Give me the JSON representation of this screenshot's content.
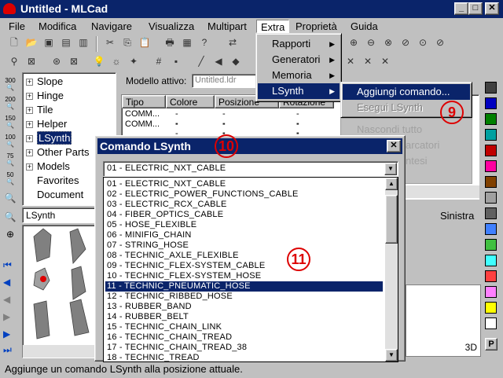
{
  "window": {
    "title": "Untitled - MLCad",
    "min_label": "_",
    "max_label": "□",
    "close_label": "✕"
  },
  "menubar": {
    "items": [
      "File",
      "Modifica",
      "Navigare",
      "Visualizza",
      "Multipart",
      "Extra",
      "Proprietà",
      "Guida"
    ]
  },
  "extra_menu": {
    "items": [
      "Rapporti",
      "Generatori",
      "Memoria",
      "LSynth"
    ]
  },
  "lsynth_menu": {
    "items": [
      {
        "label": "Aggiungi comando...",
        "enabled": true
      },
      {
        "label": "Esegui LSynth",
        "enabled": false
      }
    ]
  },
  "hidden_menu_fragments": [
    "Nascondi tutto",
    "arcatori",
    "ntesi"
  ],
  "zoom_labels": [
    "300",
    "200",
    "150",
    "100",
    "75",
    "50"
  ],
  "parts_tree": {
    "items": [
      {
        "label": "Slope",
        "expander": "+"
      },
      {
        "label": "Hinge",
        "expander": "+"
      },
      {
        "label": "Tile",
        "expander": "+"
      },
      {
        "label": "Helper",
        "expander": "+"
      },
      {
        "label": "LSynth",
        "expander": "+",
        "selected": true
      },
      {
        "label": "Other Parts",
        "expander": "+"
      },
      {
        "label": "Models",
        "expander": "+"
      },
      {
        "label": "Favorites",
        "expander": ""
      },
      {
        "label": "Document",
        "expander": ""
      }
    ]
  },
  "preview": {
    "combo_value": "LSynth"
  },
  "model": {
    "label": "Modello attivo:",
    "value": "Untitled.ldr",
    "columns": [
      "Tipo",
      "Colore",
      "Posizione",
      "Rotazione"
    ],
    "rows": [
      {
        "type": "COMM...",
        "color": "--",
        "position": "-----",
        "rotation": "-----"
      },
      {
        "type": "COMM...",
        "color": "--",
        "position": "-----",
        "rotation": "-----"
      }
    ]
  },
  "view_labels": {
    "left": "Sinistra",
    "mode": "3D"
  },
  "dialog": {
    "title": "Comando LSynth",
    "close_label": "✕",
    "combo_value": "01 - ELECTRIC_NXT_CABLE",
    "options": [
      "01 - ELECTRIC_NXT_CABLE",
      "02 - ELECTRIC_POWER_FUNCTIONS_CABLE",
      "03 - ELECTRIC_RCX_CABLE",
      "04 - FIBER_OPTICS_CABLE",
      "05 - HOSE_FLEXIBLE",
      "06 - MINIFIG_CHAIN",
      "07 - STRING_HOSE",
      "08 - TECHNIC_AXLE_FLEXIBLE",
      "09 - TECHNIC_FLEX-SYSTEM_CABLE",
      "10 - TECHNIC_FLEX-SYSTEM_HOSE",
      "11 - TECHNIC_PNEUMATIC_HOSE",
      "12 - TECHNIC_RIBBED_HOSE",
      "13 - RUBBER_BAND",
      "14 - RUBBER_BELT",
      "15 - TECHNIC_CHAIN_LINK",
      "16 - TECHNIC_CHAIN_TREAD",
      "17 - TECHNIC_CHAIN_TREAD_38",
      "18 - TECHNIC_TREAD"
    ],
    "selected_index": 10
  },
  "annotations": [
    "9",
    "10",
    "11"
  ],
  "palette": {
    "colors": [
      "#404040",
      "#0000c0",
      "#008000",
      "#00a0a0",
      "#c00000",
      "#ff00a0",
      "#804000",
      "#a0a0a0",
      "#606060",
      "#4080ff",
      "#40c040",
      "#40ffff",
      "#ff4040",
      "#ff80ff",
      "#ffff00",
      "#ffffff"
    ],
    "bottom_label": "P"
  },
  "statusbar": {
    "text": "Aggiunge un comando LSynth alla posizione attuale."
  }
}
